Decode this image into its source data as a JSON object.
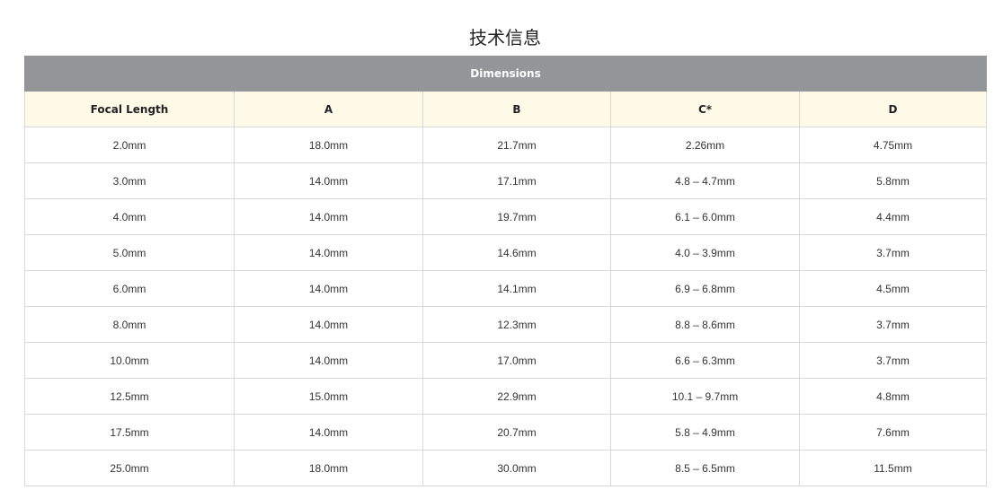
{
  "page": {
    "title": "技术信息"
  },
  "table": {
    "banner": "Dimensions",
    "columns": [
      "Focal Length",
      "A",
      "B",
      "C*",
      "D"
    ],
    "rows": [
      [
        "2.0mm",
        "18.0mm",
        "21.7mm",
        "2.26mm",
        "4.75mm"
      ],
      [
        "3.0mm",
        "14.0mm",
        "17.1mm",
        "4.8 – 4.7mm",
        "5.8mm"
      ],
      [
        "4.0mm",
        "14.0mm",
        "19.7mm",
        "6.1 – 6.0mm",
        "4.4mm"
      ],
      [
        "5.0mm",
        "14.0mm",
        "14.6mm",
        "4.0 – 3.9mm",
        "3.7mm"
      ],
      [
        "6.0mm",
        "14.0mm",
        "14.1mm",
        "6.9 – 6.8mm",
        "4.5mm"
      ],
      [
        "8.0mm",
        "14.0mm",
        "12.3mm",
        "8.8 – 8.6mm",
        "3.7mm"
      ],
      [
        "10.0mm",
        "14.0mm",
        "17.0mm",
        "6.6 – 6.3mm",
        "3.7mm"
      ],
      [
        "12.5mm",
        "15.0mm",
        "22.9mm",
        "10.1 – 9.7mm",
        "4.8mm"
      ],
      [
        "17.5mm",
        "14.0mm",
        "20.7mm",
        "5.8 – 4.9mm",
        "7.6mm"
      ],
      [
        "25.0mm",
        "18.0mm",
        "30.0mm",
        "8.5 – 6.5mm",
        "11.5mm"
      ]
    ]
  },
  "colors": {
    "banner_bg": "#939598",
    "header_bg": "#fffae8",
    "border": "#d8d8d8"
  }
}
